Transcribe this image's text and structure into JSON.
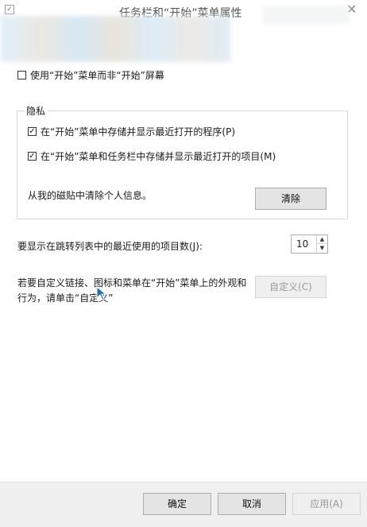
{
  "window": {
    "title": "任务栏和“开始”菜单属性",
    "close_glyph": "✕",
    "icon_glyph": "✓"
  },
  "options": {
    "use_start_menu": {
      "label": "使用“开始”菜单而非“开始”屏幕",
      "checked": false
    }
  },
  "privacy": {
    "group_title": "隐私",
    "store_recent_programs": {
      "label": "在“开始”菜单中存储并显示最近打开的程序(P)",
      "checked": true
    },
    "store_recent_items": {
      "label": "在“开始”菜单和任务栏中存储并显示最近打开的项目(M)",
      "checked": true
    },
    "clear_text": "从我的磁贴中清除个人信息。",
    "clear_button": "清除"
  },
  "jump_list": {
    "label": "要显示在跳转列表中的最近使用的项目数(J):",
    "value": "10",
    "up_glyph": "▲",
    "down_glyph": "▼"
  },
  "customize": {
    "text_line1": "若要自定义链接、图标和菜单在“开始”菜单上的外观和",
    "text_line2": "行为，请单击“自定义”",
    "button": "自定义(C)"
  },
  "footer": {
    "ok": "确定",
    "cancel": "取消",
    "apply": "应用(A)"
  },
  "colors": {
    "cursor": "#1f6fb2"
  }
}
